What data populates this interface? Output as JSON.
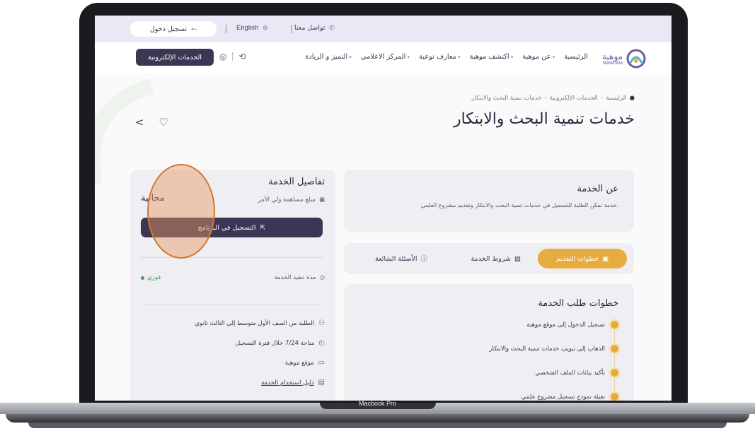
{
  "device": {
    "label": "Macbook Pro"
  },
  "topbar": {
    "contact_label": "تواصل معنا",
    "lang_label": "English",
    "login_label": "تسجيل دخول"
  },
  "brand": {
    "name_ar": "موهبة",
    "name_en": "Mawhiba"
  },
  "nav": {
    "items": [
      {
        "label": "الرئيسية",
        "caret": false
      },
      {
        "label": "عن موهبة",
        "caret": true
      },
      {
        "label": "اكتشف موهبة",
        "caret": true
      },
      {
        "label": "معارف نوعية",
        "caret": true
      },
      {
        "label": "المركز الاعلامي",
        "caret": true
      },
      {
        "label": "التميز و الريادة",
        "caret": true
      }
    ],
    "eservices_label": "الخدمات الإلكترونية"
  },
  "breadcrumb": {
    "items": [
      "الرئيسية",
      "الخدمات الإلكترونية",
      "خدمات تنمية البحث والابتكار"
    ]
  },
  "page": {
    "title": "خدمات تنمية البحث والابتكار"
  },
  "about": {
    "title": "عن الخدمة",
    "description": "خدمة تمكن الطلبة للتسجيل في خدمات تنمية البحث والابتكار وتقديم مشروع العلمي."
  },
  "tabs": {
    "steps": "خطوات التقديم",
    "terms": "شروط الخدمة",
    "faq": "الأسئلة الشائعة"
  },
  "steps": {
    "title": "خطوات طلب الخدمة",
    "items": [
      "تسجيل الدخول إلى موقع موهبة",
      "الذهاب إلى تبويب خدمات تنمية البحث والابتكار",
      "تأكيد بيانات الملف الشخصي",
      "تعبئة نموذج تسجيل مشروع علمي"
    ]
  },
  "details": {
    "title": "تفاصيل الخدمة",
    "fee_label": "مبلغ مساهمة ولي الأمر",
    "fee_value": "مجانية",
    "register_label": "التسجيل في البرنامج",
    "duration_label": "مدة تنفيذ الخدمة",
    "duration_value": "فوري",
    "audience": "الطلبة من الصف الأول متوسط إلى الثالث ثانوي",
    "availability": "متاحة 7/24 خلال فترة التسجيل",
    "channel": "موقع موهبة",
    "guide_label": "دليل استخدام الخدمة"
  },
  "colors": {
    "primary": "#3c3553",
    "accent": "#e6ac3f",
    "card_bg": "#efeff3",
    "topbar_bg": "#ebe7f4",
    "success": "#3c9b5c"
  },
  "icons": {
    "phone": "phone-icon",
    "globe": "globe-icon",
    "arrow": "arrow-left-icon",
    "share": "share-icon",
    "heart": "heart-icon"
  }
}
